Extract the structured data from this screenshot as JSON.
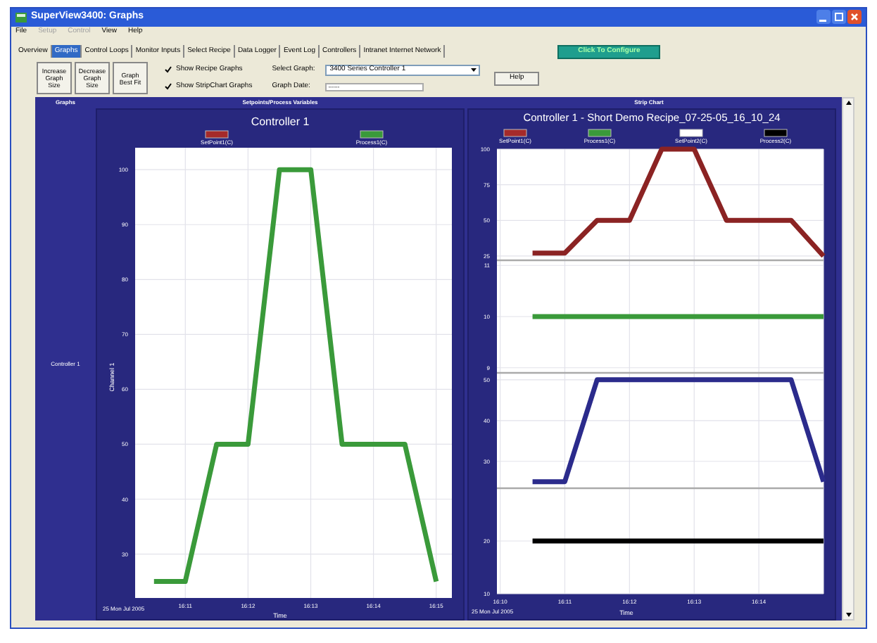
{
  "window": {
    "title": "SuperView3400: Graphs"
  },
  "menu": [
    {
      "label": "File",
      "disabled": false
    },
    {
      "label": "Setup",
      "disabled": true
    },
    {
      "label": "Control",
      "disabled": true
    },
    {
      "label": "View",
      "disabled": false
    },
    {
      "label": "Help",
      "disabled": false
    }
  ],
  "tabs": [
    {
      "label": "Overview",
      "selected": false
    },
    {
      "label": "Graphs",
      "selected": true
    },
    {
      "label": "Control Loops",
      "selected": false
    },
    {
      "label": "Monitor Inputs",
      "selected": false
    },
    {
      "label": "Select Recipe",
      "selected": false
    },
    {
      "label": "Data Logger",
      "selected": false
    },
    {
      "label": "Event Log",
      "selected": false
    },
    {
      "label": "Controllers",
      "selected": false
    },
    {
      "label": "Intranet Internet Network",
      "selected": false
    }
  ],
  "configure_button": "Click To Configure",
  "toolbar": {
    "buttons": [
      "Increase Graph Size",
      "Decrease Graph Size",
      "Graph Best Fit"
    ],
    "checkboxes": [
      {
        "label": "Show Recipe Graphs",
        "checked": true
      },
      {
        "label": "Show StripChart Graphs",
        "checked": true
      }
    ],
    "select_graph": {
      "label": "Select Graph:",
      "value": "3400 Series Controller 1"
    },
    "graph_date": {
      "label": "Graph Date:",
      "value": "------"
    },
    "help_button": "Help"
  },
  "graphs_panel": {
    "header": "Graphs",
    "row_label": "Controller 1",
    "recipe_graph": {
      "header": "Setpoints/Process Variables",
      "date": "25 Mon Jul 2005",
      "legend": [
        {
          "label": "SetPoint1(C)",
          "color": "#a52a2a"
        }
      ],
      "chart_data": {
        "type": "line",
        "grid": true,
        "title": "Controller 1",
        "xlabel": "Time",
        "ylabel": "Channel 1",
        "categories": [
          null,
          "16:11",
          null,
          "16:12",
          null,
          "16:13",
          null,
          "16:14",
          null,
          "16:15"
        ],
        "series": [
          {
            "name": "Process1(C)",
            "color": "#3a9a3a",
            "values": [
              25,
              25,
              50,
              50,
              100,
              100,
              50,
              50,
              50,
              25
            ]
          }
        ],
        "ylim": [
          22,
          104
        ],
        "yticks": [
          30,
          40,
          50,
          60,
          70,
          80,
          90,
          100
        ]
      }
    },
    "strip_chart": {
      "header": "Strip Chart",
      "title": "Controller 1 - Short Demo Recipe_07-25-05_16_10_24",
      "date": "25 Mon Jul 2005",
      "xlabel": "Time",
      "panes": [
        {
          "color": "#a52a2a",
          "chart_data": {
            "type": "line",
            "grid": true,
            "categories": [
              null,
              null,
              null,
              null,
              null,
              null,
              null,
              null,
              null,
              null,
              null
            ],
            "series": [
              {
                "name": "SetPoint1(C)",
                "color": "#8b2323",
                "values": [
                  null,
                  27,
                  27,
                  50,
                  50,
                  100,
                  100,
                  50,
                  50,
                  50,
                  25
                ]
              }
            ],
            "ylim": [
              22,
              100
            ],
            "yticks": [
              25,
              50,
              75,
              100
            ]
          }
        },
        {
          "color": "#3a9a3a",
          "chart_data": {
            "type": "line",
            "grid": true,
            "categories": [
              null,
              null,
              null,
              null,
              null,
              null,
              null,
              null,
              null,
              null,
              null
            ],
            "series": [
              {
                "name": "Process1(C)",
                "color": "#3a9a3a",
                "values": [
                  null,
                  10,
                  10,
                  10,
                  10,
                  10,
                  10,
                  10,
                  10,
                  10,
                  10
                ]
              }
            ],
            "ylim": [
              8.9,
              11.1
            ],
            "yticks": [
              9,
              10,
              11
            ]
          }
        },
        {
          "color": "#ffffff",
          "chart_data": {
            "type": "line",
            "grid": true,
            "categories": [
              null,
              null,
              null,
              null,
              null,
              null,
              null,
              null,
              null,
              null,
              null
            ],
            "series": [
              {
                "name": "SetPoint2(C)",
                "color": "#2b2b8c",
                "values": [
                  null,
                  25,
                  25,
                  50,
                  50,
                  50,
                  50,
                  50,
                  50,
                  50,
                  25
                ]
              }
            ],
            "ylim": [
              23.4,
              51.7
            ],
            "yticks": [
              30,
              40,
              50
            ]
          }
        },
        {
          "color": "#000000",
          "chart_data": {
            "type": "line",
            "grid": true,
            "categories": [
              "16:10",
              null,
              "16:11",
              null,
              "16:12",
              null,
              "16:13",
              null,
              "16:14",
              null,
              null
            ],
            "series": [
              {
                "name": "Process2(C)",
                "color": "#000000",
                "values": [
                  null,
                  20,
                  20,
                  20,
                  20,
                  20,
                  20,
                  20,
                  20,
                  20,
                  20
                ]
              }
            ],
            "ylim": [
              10,
              30
            ],
            "yticks": [
              10,
              20
            ]
          }
        }
      ]
    }
  }
}
